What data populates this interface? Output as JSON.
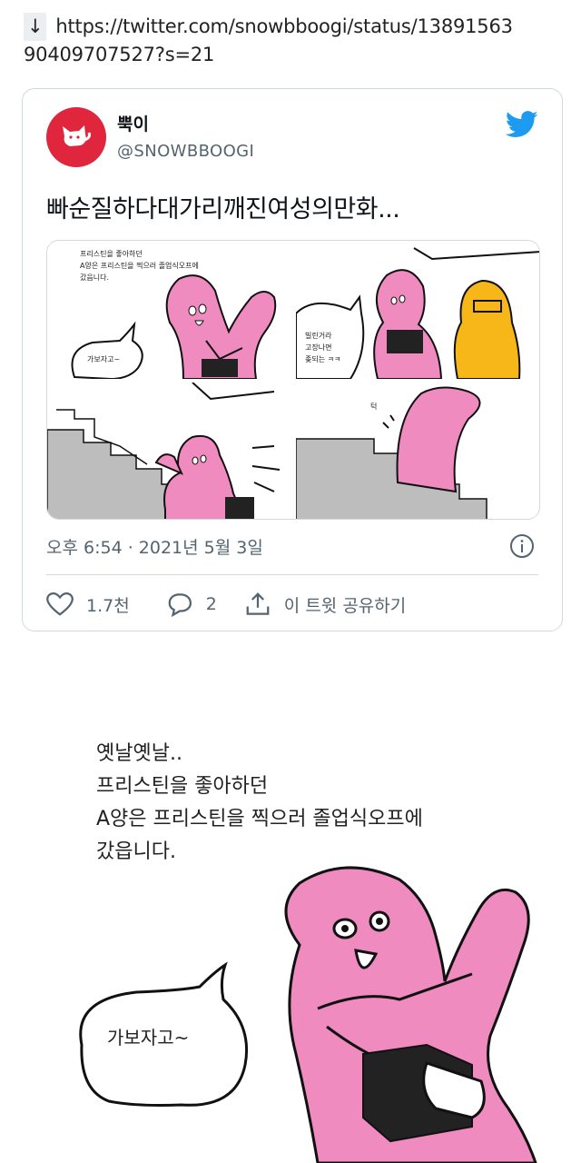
{
  "source": {
    "arrow": "↓",
    "url_line1": "https://twitter.com/snowbboogi/status/13891563",
    "url_line2": "90409707527?s=21"
  },
  "tweet": {
    "display_name": "뿍이",
    "handle": "@SNOWBBOOGI",
    "text": "빠순질하다대가리깨진여성의만화...",
    "timestamp": "오후 6:54 · 2021년 5월 3일",
    "likes": "1.7천",
    "replies": "2",
    "share_label": "이 트윗 공유하기",
    "colors": {
      "avatar": "#e0263d",
      "twitter_blue": "#1d9bf0",
      "muted": "#536471"
    }
  },
  "thumbnail": {
    "panel1_lines": [
      "프리스틴을 좋아하던",
      "A양은 프리스틴을 찍으러 졸업식오프에",
      "갔읍니다."
    ],
    "panel1_bubble": "가보자고~",
    "panel2_bubble_lines": [
      "빌린거라",
      "고장나면",
      "좆되는 ㅋㅋ"
    ],
    "panel4_sfx": "턱"
  },
  "comic": {
    "lines": [
      "옛날옛날..",
      "프리스틴을 좋아하던",
      "A양은 프리스틴을 찍으러 졸업식오프에",
      "갔읍니다."
    ],
    "bubble": "가보자고~",
    "colors": {
      "character": "#f08bc0",
      "yellow": "#f7b718"
    }
  }
}
